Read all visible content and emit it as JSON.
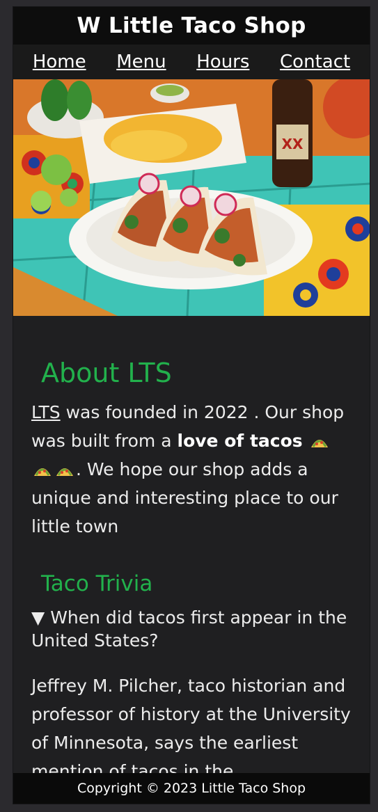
{
  "header": {
    "title": "W Little Taco Shop"
  },
  "nav": {
    "items": [
      "Home",
      "Menu",
      "Hours",
      "Contact"
    ]
  },
  "hero": {
    "alt": "Three tacos on a white plate with chips and drink on a colorful tiled table"
  },
  "about": {
    "heading": "About LTS",
    "lts": "LTS",
    "text_1": " was founded in 2022 . Our shop was built from a ",
    "bold": "love of tacos",
    "text_2": ". We hope our shop adds a unique and interesting place to our little town"
  },
  "trivia": {
    "heading": "Taco Trivia",
    "marker": "▼",
    "question": "When did tacos first appear in the United States?",
    "answer": "Jeffrey M. Pilcher, taco historian and professor of history at the University of Minnesota, says the earliest mention of tacos in the"
  },
  "footer": {
    "text": "Copyright © 2023 Little Taco Shop"
  }
}
